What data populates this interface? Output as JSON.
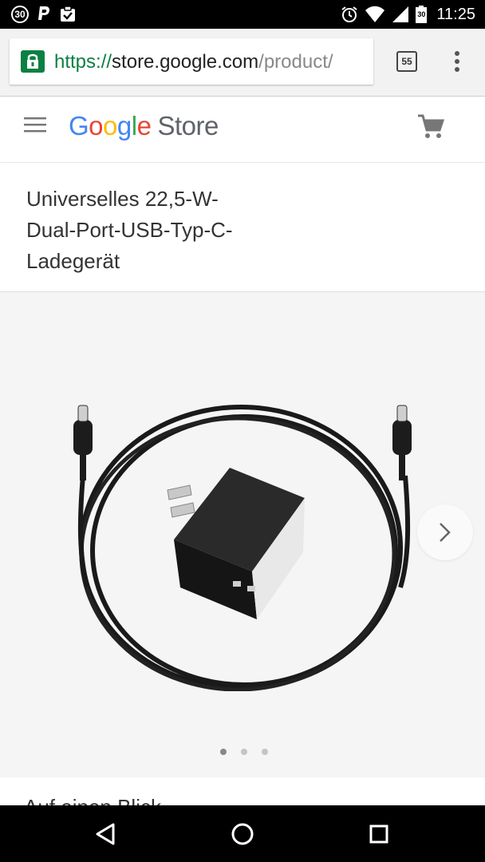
{
  "status_bar": {
    "notification_count": "30",
    "battery_level": "30",
    "time": "11:25"
  },
  "browser": {
    "url_scheme": "https://",
    "url_host": "store.google.com",
    "url_path": "/product/",
    "tab_count": "55"
  },
  "header": {
    "logo_letters": [
      "G",
      "o",
      "o",
      "g",
      "l",
      "e"
    ],
    "logo_store": "Store"
  },
  "product": {
    "title": "Universelles 22,5-W-Dual-Port-USB-Typ-C-Ladegerät",
    "gallery": {
      "total_slides": 3,
      "active_slide": 1
    }
  },
  "below_section": {
    "heading_partial": "Auf einen Blick"
  },
  "colors": {
    "secure_green": "#0b8043",
    "google_blue": "#4285f4",
    "google_red": "#ea4335",
    "google_yellow": "#fbbc05",
    "google_green": "#34a853"
  },
  "icons": {
    "notification": "circle-number-icon",
    "paypal": "paypal-icon",
    "clipboard": "clipboard-check-icon",
    "alarm": "alarm-icon",
    "wifi": "wifi-icon",
    "signal": "signal-icon",
    "battery": "battery-icon",
    "lock": "lock-icon",
    "menu": "hamburger-icon",
    "cart": "cart-icon",
    "next": "chevron-right-icon",
    "nav_back": "back-triangle-icon",
    "nav_home": "home-circle-icon",
    "nav_recents": "recents-square-icon"
  }
}
